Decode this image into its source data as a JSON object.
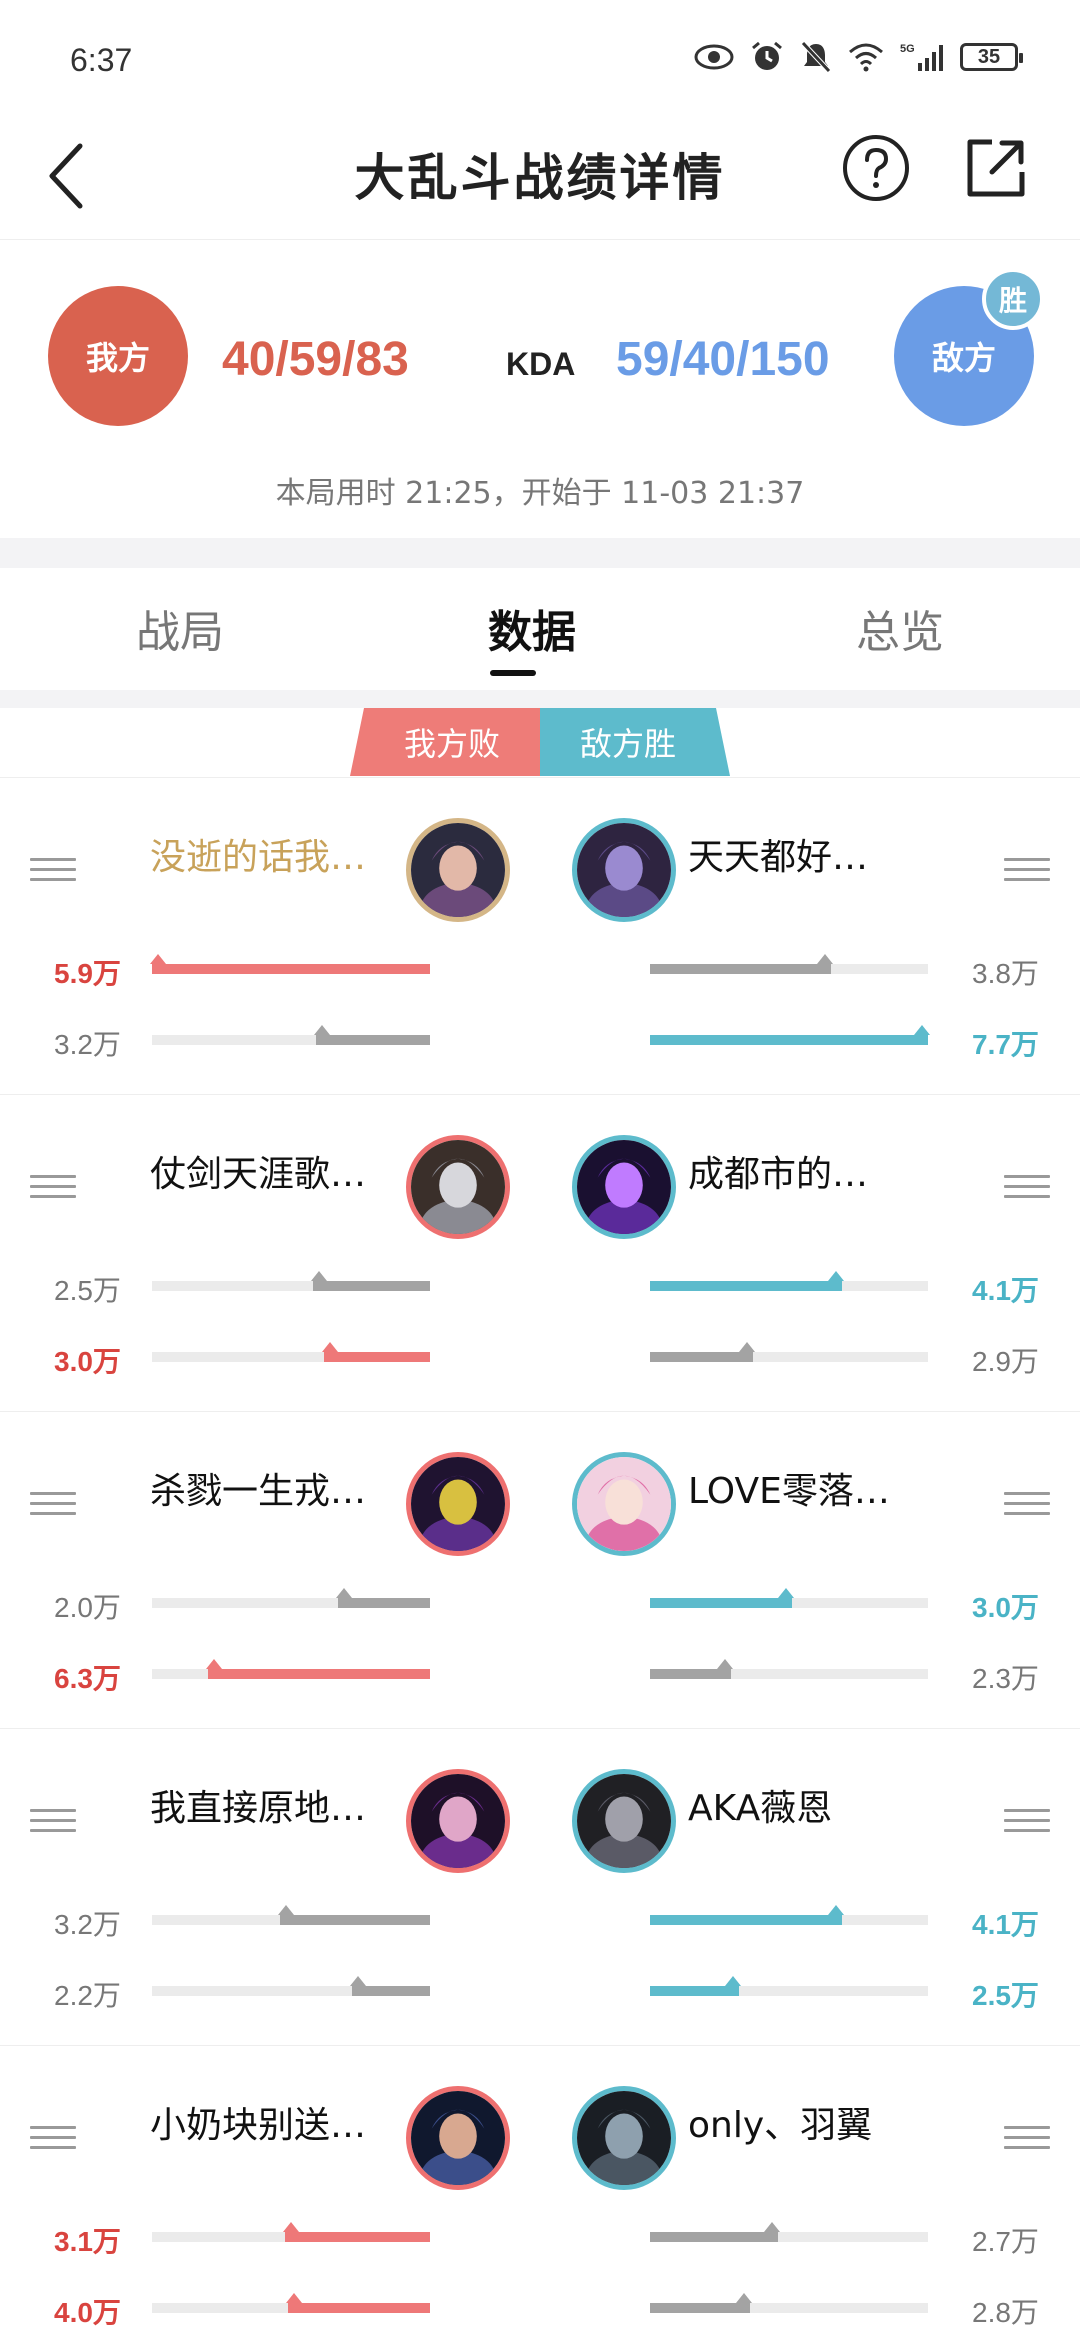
{
  "status_bar": {
    "time": "6:37",
    "battery": "35"
  },
  "header": {
    "title": "大乱斗战绩详情"
  },
  "score": {
    "my_team_label": "我方",
    "enemy_team_label": "敌方",
    "win_badge": "胜",
    "my_kda": "40/59/83",
    "kda_label": "KDA",
    "enemy_kda": "59/40/150",
    "duration_text": "本局用时 21:25，开始于 11-03 21:37"
  },
  "tabs": [
    {
      "label": "战局",
      "active": false
    },
    {
      "label": "数据",
      "active": true
    },
    {
      "label": "总览",
      "active": false
    }
  ],
  "result_ribbon": {
    "my_result": "我方败",
    "enemy_result": "敌方胜"
  },
  "colors": {
    "my_team": "#d9624f",
    "enemy_team": "#6a9ce6",
    "lose_ribbon": "#ee7c78",
    "win_ribbon": "#5dbbcc"
  },
  "players": [
    {
      "left": {
        "name": "没逝的话我…",
        "name_gold": true,
        "avatar": "female-hunter-avatar",
        "avatar_gold": true,
        "stat1": {
          "value": "5.9万",
          "ratio": 1.0,
          "highlight": true
        },
        "stat2": {
          "value": "3.2万",
          "ratio": 0.41,
          "highlight": false
        }
      },
      "right": {
        "name": "天天都好…",
        "avatar": "purple-brute-avatar",
        "stat1": {
          "value": "3.8万",
          "ratio": 0.65,
          "highlight": false
        },
        "stat2": {
          "value": "7.7万",
          "ratio": 1.0,
          "highlight": true
        }
      }
    },
    {
      "left": {
        "name": "仗剑天涯歌…",
        "avatar": "masked-warrior-avatar",
        "stat1": {
          "value": "2.5万",
          "ratio": 0.42,
          "highlight": false
        },
        "stat2": {
          "value": "3.0万",
          "ratio": 0.38,
          "highlight": true
        }
      },
      "right": {
        "name": "成都市的…",
        "avatar": "void-crystal-avatar",
        "stat1": {
          "value": "4.1万",
          "ratio": 0.69,
          "highlight": true
        },
        "stat2": {
          "value": "2.9万",
          "ratio": 0.37,
          "highlight": false
        }
      }
    },
    {
      "left": {
        "name": "杀戮一生戎…",
        "avatar": "purple-monster-avatar",
        "stat1": {
          "value": "2.0万",
          "ratio": 0.33,
          "highlight": false
        },
        "stat2": {
          "value": "6.3万",
          "ratio": 0.8,
          "highlight": true
        }
      },
      "right": {
        "name": "LOVE零落…",
        "avatar": "pink-hair-avatar",
        "stat1": {
          "value": "3.0万",
          "ratio": 0.51,
          "highlight": true
        },
        "stat2": {
          "value": "2.3万",
          "ratio": 0.29,
          "highlight": false
        }
      }
    },
    {
      "left": {
        "name": "我直接原地…",
        "avatar": "dark-sorceress-avatar",
        "stat1": {
          "value": "3.2万",
          "ratio": 0.54,
          "highlight": false
        },
        "stat2": {
          "value": "2.2万",
          "ratio": 0.28,
          "highlight": false
        }
      },
      "right": {
        "name": "AKA薇恩",
        "avatar": "helmet-ranger-avatar",
        "stat1": {
          "value": "4.1万",
          "ratio": 0.69,
          "highlight": true
        },
        "stat2": {
          "value": "2.5万",
          "ratio": 0.32,
          "highlight": true
        }
      }
    },
    {
      "left": {
        "name": "小奶块别送…",
        "avatar": "blue-swordsman-avatar",
        "stat1": {
          "value": "3.1万",
          "ratio": 0.52,
          "highlight": true
        },
        "stat2": {
          "value": "4.0万",
          "ratio": 0.51,
          "highlight": true
        }
      },
      "right": {
        "name": "only、羽翼",
        "avatar": "steel-golem-avatar",
        "stat1": {
          "value": "2.7万",
          "ratio": 0.46,
          "highlight": false
        },
        "stat2": {
          "value": "2.8万",
          "ratio": 0.36,
          "highlight": false
        }
      }
    }
  ]
}
